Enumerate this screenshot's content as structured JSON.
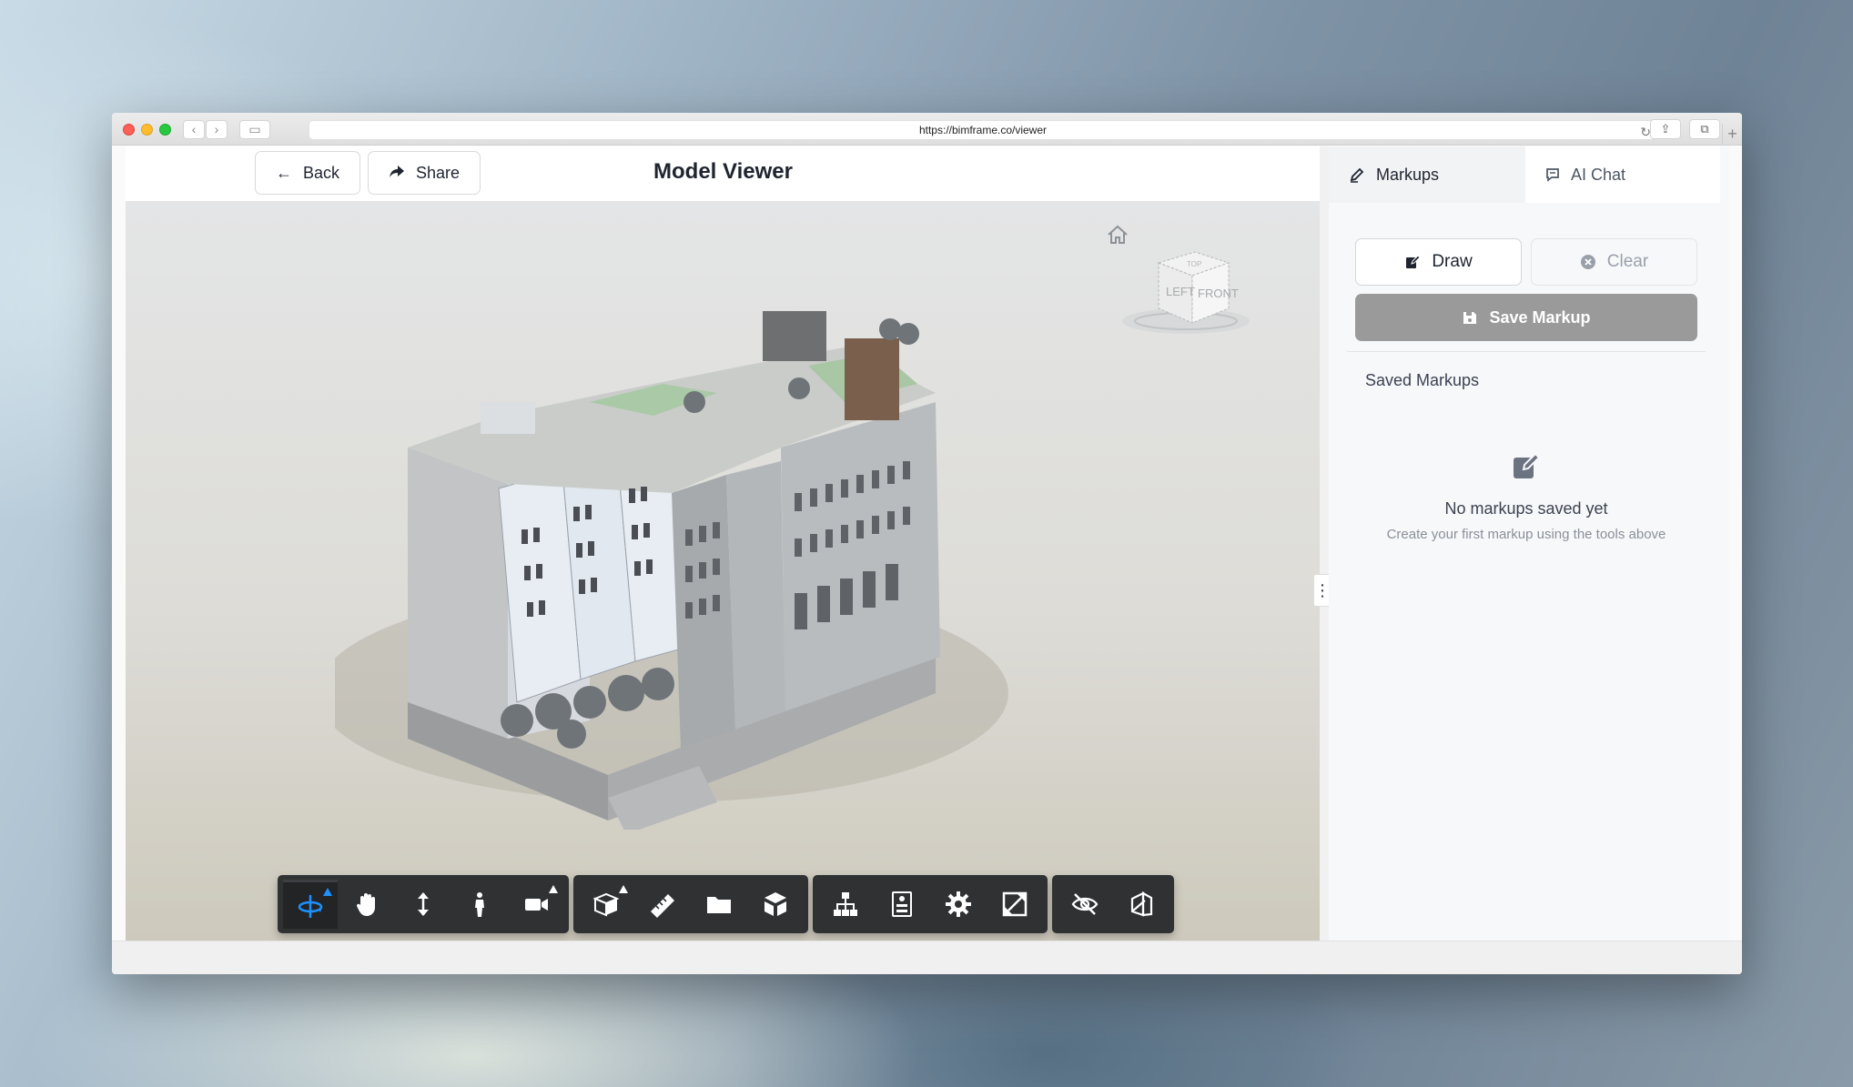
{
  "browser": {
    "url": "https://bimframe.co/viewer"
  },
  "header": {
    "back_label": "Back",
    "share_label": "Share",
    "title": "Model Viewer"
  },
  "viewcube": {
    "faces": [
      "TOP",
      "LEFT",
      "FRONT"
    ]
  },
  "toolbar": {
    "groups": [
      [
        {
          "icon": "orbit-icon",
          "active": true,
          "has_submenu": true
        },
        {
          "icon": "pan-hand-icon"
        },
        {
          "icon": "zoom-arrows-icon"
        },
        {
          "icon": "first-person-icon"
        },
        {
          "icon": "camera-icon",
          "has_submenu": true
        }
      ],
      [
        {
          "icon": "section-box-icon",
          "has_submenu": true
        },
        {
          "icon": "measure-ruler-icon"
        },
        {
          "icon": "folder-icon"
        },
        {
          "icon": "explode-cube-icon"
        }
      ],
      [
        {
          "icon": "model-tree-icon"
        },
        {
          "icon": "properties-icon"
        },
        {
          "icon": "settings-gear-icon"
        },
        {
          "icon": "fullscreen-icon"
        }
      ],
      [
        {
          "icon": "hide-eye-icon"
        },
        {
          "icon": "isolate-icon"
        }
      ]
    ]
  },
  "panel": {
    "tabs": [
      {
        "label": "Markups",
        "active": true
      },
      {
        "label": "AI Chat",
        "active": false
      }
    ],
    "draw_label": "Draw",
    "clear_label": "Clear",
    "save_label": "Save Markup",
    "saved_title": "Saved Markups",
    "empty_title": "No markups saved yet",
    "empty_subtitle": "Create your first markup using the tools above"
  },
  "colors": {
    "accent": "#1e90ff",
    "toolbar_bg": "#2f3133",
    "save_button_bg": "#9a9a9a"
  }
}
